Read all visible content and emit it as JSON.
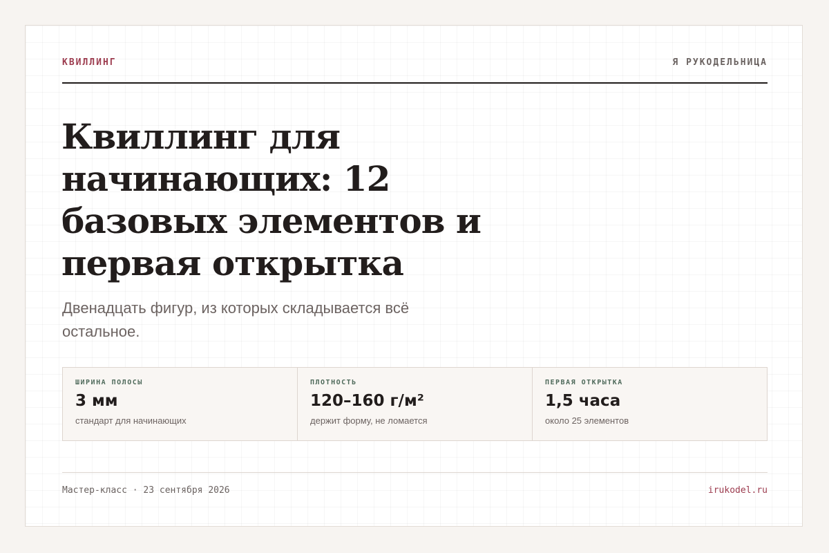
{
  "header": {
    "kicker": "КВИЛЛИНГ",
    "brand": "Я РУКОДЕЛЬНИЦА"
  },
  "article": {
    "title": "Квиллинг для начинающих: 12 базовых элементов и первая открытка",
    "subtitle": "Двенадцать фигур, из которых складывается всё остальное."
  },
  "stats": [
    {
      "label": "ШИРИНА ПОЛОСЫ",
      "value": "3 мм",
      "note": "стандарт для начинающих"
    },
    {
      "label": "ПЛОТНОСТЬ",
      "value": "120–160 г/м²",
      "note": "держит форму, не ломается"
    },
    {
      "label": "ПЕРВАЯ ОТКРЫТКА",
      "value": "1,5 часа",
      "note": "около 25 элементов"
    }
  ],
  "footer": {
    "date": "Мастер-класс · 23 сентября 2026",
    "url": "irukodel.ru"
  },
  "colors": {
    "accent": "#9c3b4e",
    "label_green": "#4f6a5b",
    "text_dark": "#221d1c",
    "muted": "#6c6361"
  }
}
